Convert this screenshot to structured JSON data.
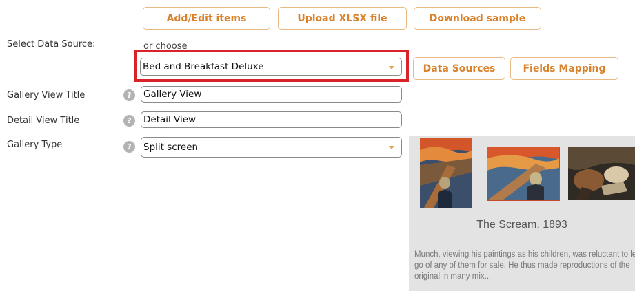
{
  "toolbar": {
    "add_edit": "Add/Edit items",
    "upload": "Upload XLSX file",
    "download": "Download sample"
  },
  "data_source": {
    "label": "Select Data Source:",
    "or_choose": "or choose",
    "selected": "Bed and Breakfast Deluxe",
    "data_sources_button": "Data Sources",
    "fields_mapping_button": "Fields Mapping"
  },
  "gallery_view_title": {
    "label": "Gallery View Title",
    "value": "Gallery View"
  },
  "detail_view_title": {
    "label": "Detail View Title",
    "value": "Detail View"
  },
  "gallery_type": {
    "label": "Gallery Type",
    "value": "Split screen"
  },
  "help_glyph": "?",
  "preview": {
    "caption": "The Scream, 1893",
    "description": "Munch, viewing his paintings as his children, was reluctant to let go of any of them for sale. He thus made reproductions of the original in many mix..."
  },
  "colors": {
    "accent": "#d9822b",
    "button_border": "#e8b985",
    "highlight": "#d8232a"
  }
}
